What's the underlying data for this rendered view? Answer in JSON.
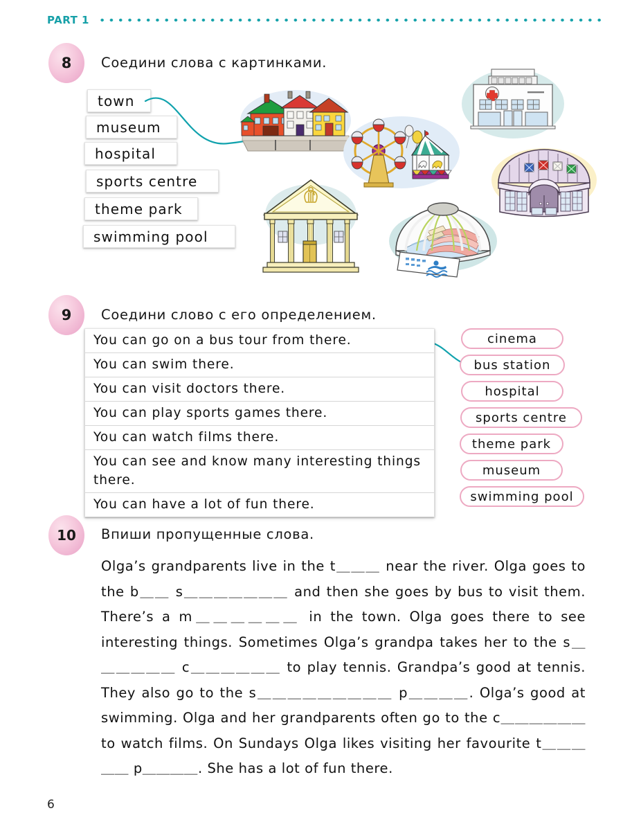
{
  "header": {
    "part_label": "PART 1",
    "accent_color": "#17a3ab"
  },
  "page_number": "6",
  "exercises": [
    {
      "number": "8",
      "instruction": "Соедини  слова  с  картинками.",
      "word_boxes": [
        "town",
        "museum",
        "hospital",
        "sports  centre",
        "theme  park",
        "swimming  pool"
      ],
      "pictures": [
        {
          "name": "town-houses-picture",
          "alt": "row of colourful town houses by a road"
        },
        {
          "name": "hospital-picture",
          "alt": "white hospital building with red cross"
        },
        {
          "name": "theme-park-picture",
          "alt": "ferris wheel and carousel"
        },
        {
          "name": "museum-picture",
          "alt": "classical museum with columns and lyre"
        },
        {
          "name": "sports-centre-picture",
          "alt": "domed sports centre with flags"
        },
        {
          "name": "swimming-pool-picture",
          "alt": "domed swimming pool with swimmer sign"
        }
      ],
      "connector": "town-to-town-picture"
    },
    {
      "number": "9",
      "instruction": "Соедини  слово  с  его  определением.",
      "sentences": [
        "You  can  go  on  a  bus  tour  from  there.",
        "You  can  swim  there.",
        "You  can  visit  doctors  there.",
        "You  can  play  sports  games  there.",
        "You  can  watch  films  there.",
        "You  can  see  and  know  many  interesting  things  there.",
        "You  can  have  a  lot  of  fun  there."
      ],
      "chips": [
        "cinema",
        "bus  station",
        "hospital",
        "sports  centre",
        "theme  park",
        "museum",
        "swimming  pool"
      ],
      "chip_border_color": "#eda9c2",
      "connector": "first-sentence-to-bus-station-chip"
    },
    {
      "number": "10",
      "instruction": "Впиши  пропущенные  слова.",
      "paragraph": "Olga’s  grandparents  live  in  the  t＿＿＿  near  the  river.  Olga  goes  to  the  b＿＿  s＿＿＿＿＿＿＿  and  then  she  goes  by  bus  to  visit  them.  There’s  a  m＿＿＿＿＿＿  in  the  town.  Olga  goes  there  to  see  interesting  things.  Sometimes  Olga’s  grandpa  takes  her  to  the  s＿＿＿＿＿＿  c＿＿＿＿＿＿  to  play  tennis.  Grandpa’s  good  at  tennis.  They  also  go  to  the  s＿＿＿＿＿＿＿＿＿  p＿＿＿＿.  Olga’s  good  at  swimming.  Olga  and  her  grandparents  often  go  to  the  c＿＿＿＿＿＿  to  watch  films.  On  Sundays  Olga  likes  visiting  her  favourite  t＿＿＿＿＿  p＿＿＿＿.   She  has  a  lot  of  fun  there."
    }
  ]
}
